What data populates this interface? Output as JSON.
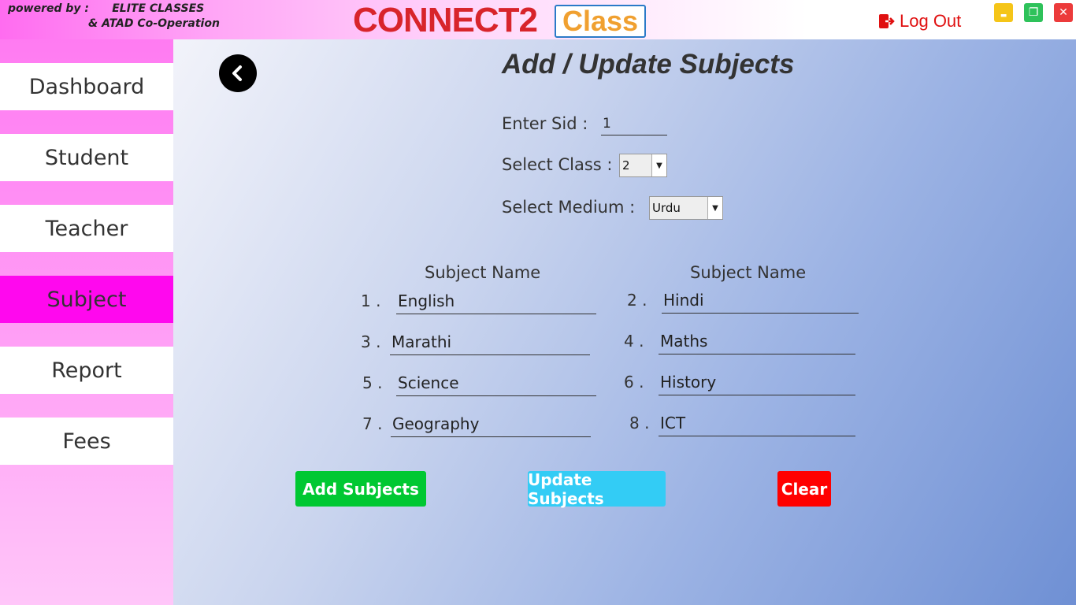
{
  "header": {
    "powered_line1": "powered by :      ELITE CLASSES",
    "powered_line2": "& ATAD Co-Operation",
    "logo_text": "CONNECT2",
    "logo_class": "Class",
    "logout_label": "Log Out"
  },
  "window_controls": {
    "minimize": "▬",
    "restore": "❐",
    "close": "✕"
  },
  "sidebar": {
    "items": [
      {
        "label": "Dashboard"
      },
      {
        "label": "Student"
      },
      {
        "label": "Teacher"
      },
      {
        "label": "Subject",
        "active": true
      },
      {
        "label": "Report"
      },
      {
        "label": "Fees"
      }
    ]
  },
  "form": {
    "title": "Add / Update Subjects",
    "sid_label": "Enter Sid :",
    "sid_value": "1",
    "class_label": "Select Class :",
    "class_value": "2",
    "medium_label": "Select Medium :",
    "medium_value": "Urdu",
    "col_header_1": "Subject Name",
    "col_header_2": "Subject Name",
    "subjects": [
      {
        "num": "1 .",
        "value": "English"
      },
      {
        "num": "2 .",
        "value": "Hindi"
      },
      {
        "num": "3 .",
        "value": "Marathi"
      },
      {
        "num": "4 .",
        "value": "Maths"
      },
      {
        "num": "5 .",
        "value": "Science"
      },
      {
        "num": "6 .",
        "value": "History"
      },
      {
        "num": "7 .",
        "value": "Geography"
      },
      {
        "num": "8 .",
        "value": "ICT"
      }
    ]
  },
  "buttons": {
    "add": "Add Subjects",
    "update": "Update Subjects",
    "clear": "Clear"
  },
  "colors": {
    "sidebar_active": "#ff08ee",
    "add_button": "#00c832",
    "update_button": "#33ccf5",
    "clear_button": "#ff0000",
    "logout": "#e01010",
    "minimize": "#f5c518",
    "restore": "#2ec25a",
    "close": "#ec3b3b"
  }
}
